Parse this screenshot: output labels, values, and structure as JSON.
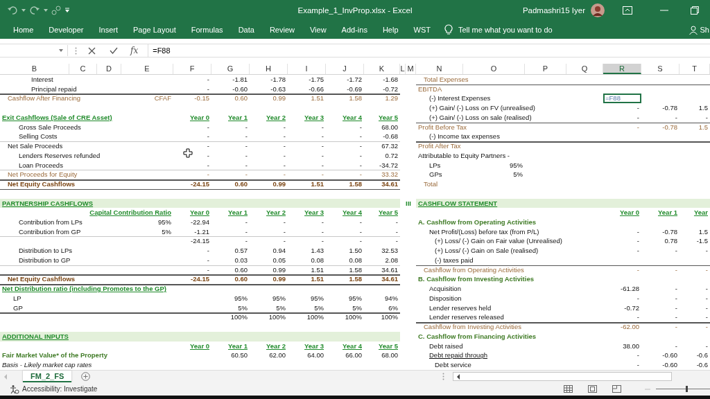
{
  "window": {
    "title": "Example_1_InvProp.xlsx  -  Excel",
    "user": "Padmashri15 Iyer"
  },
  "ribbon_tabs": [
    {
      "label": "Home",
      "selected": false
    },
    {
      "label": "Developer",
      "selected": false
    },
    {
      "label": "Insert",
      "selected": false
    },
    {
      "label": "Page Layout",
      "selected": false
    },
    {
      "label": "Formulas",
      "selected": false
    },
    {
      "label": "Data",
      "selected": false
    },
    {
      "label": "Review",
      "selected": false
    },
    {
      "label": "View",
      "selected": false
    },
    {
      "label": "Add-ins",
      "selected": false
    },
    {
      "label": "Help",
      "selected": false
    },
    {
      "label": "WST",
      "selected": false
    }
  ],
  "tell_me": {
    "placeholder": "Tell me what you want to do"
  },
  "share": {
    "label": "Sh"
  },
  "formula_bar": {
    "function_label": "fx",
    "value": "=F88"
  },
  "columns": [
    {
      "label": "B",
      "selected": false
    },
    {
      "label": "C",
      "selected": false
    },
    {
      "label": "D",
      "selected": false
    },
    {
      "label": "E",
      "selected": false
    },
    {
      "label": "F",
      "selected": false
    },
    {
      "label": "G",
      "selected": false
    },
    {
      "label": "H",
      "selected": false
    },
    {
      "label": "I",
      "selected": false
    },
    {
      "label": "J",
      "selected": false
    },
    {
      "label": "K",
      "selected": false
    },
    {
      "label": "L",
      "selected": false
    },
    {
      "label": "M",
      "selected": false
    },
    {
      "label": "N",
      "selected": false
    },
    {
      "label": "O",
      "selected": false
    },
    {
      "label": "P",
      "selected": false
    },
    {
      "label": "Q",
      "selected": false
    },
    {
      "label": "R",
      "selected": true
    },
    {
      "label": "S",
      "selected": false
    },
    {
      "label": "T",
      "selected": false
    }
  ],
  "rows": [
    {
      "left": {
        "label": "Interest",
        "kind": "detail",
        "values": [
          "-",
          "-1.81",
          "-1.78",
          "-1.75",
          "-1.72",
          "-1.68"
        ]
      },
      "right": {
        "label": "Total Expenses",
        "kind": "subtotal"
      }
    },
    {
      "left": {
        "label": "Principal repaid",
        "kind": "detail",
        "values": [
          "-",
          "-0.60",
          "-0.63",
          "-0.66",
          "-0.69",
          "-0.72"
        ]
      },
      "right": {
        "label": "EBITDA",
        "kind": "summary",
        "rule_above": true
      }
    },
    {
      "left": {
        "label": "Cashflow After Financing",
        "kind": "subtotal",
        "note": "CFAF",
        "rule_above": true,
        "values": [
          "-0.15",
          "0.60",
          "0.99",
          "1.51",
          "1.58",
          "1.29"
        ]
      },
      "right": {
        "label": "(-) Interest Expenses",
        "kind": "entry",
        "values": [
          "=F88"
        ],
        "editing": true
      }
    },
    {
      "right": {
        "label": "(+) Gain/ (-) Loss on FV (unrealised)",
        "kind": "entry",
        "values": [
          "-",
          "-0.78",
          "1.5"
        ]
      }
    },
    {
      "left": {
        "label": "Exit Cashflows (Sale of CRE Asset)",
        "kind": "heading",
        "values": [
          "Year 0",
          "Year 1",
          "Year 2",
          "Year 3",
          "Year 4",
          "Year 5"
        ]
      },
      "right": {
        "label": "(+) Gain/ (-) Loss on sale (realised)",
        "kind": "entry",
        "values": [
          "-",
          "-",
          "-"
        ]
      }
    },
    {
      "left": {
        "label": "Gross Sale Proceeds",
        "kind": "item",
        "values": [
          "-",
          "-",
          "-",
          "-",
          "-",
          "68.00"
        ]
      },
      "right": {
        "label": "Profit Before Tax",
        "kind": "summary",
        "rule_above": true,
        "values": [
          "-",
          "-0.78",
          "1.5"
        ]
      }
    },
    {
      "left": {
        "label": "Selling Costs",
        "kind": "item",
        "values": [
          "-",
          "-",
          "-",
          "-",
          "-",
          "-0.68"
        ]
      },
      "right": {
        "label": "(-) Income tax expenses",
        "kind": "entry"
      }
    },
    {
      "left": {
        "label": "Net Sale Proceeds",
        "kind": "group",
        "light_rule_above": true,
        "values": [
          "-",
          "-",
          "-",
          "-",
          "-",
          "67.32"
        ]
      },
      "right": {
        "label": "Profit After Tax",
        "kind": "summary",
        "rule_above": true
      }
    },
    {
      "left": {
        "label": "Lenders Reserves refunded",
        "kind": "item",
        "values": [
          "-",
          "-",
          "-",
          "-",
          "-",
          "0.72"
        ]
      },
      "right": {
        "label": "Attributable to Equity Partners -",
        "kind": "plain"
      }
    },
    {
      "left": {
        "label": "Loan Proceeds",
        "kind": "item",
        "values": [
          "-",
          "-",
          "-",
          "-",
          "-",
          "-34.72"
        ]
      },
      "right": {
        "label": "LPs",
        "kind": "entry",
        "note": "95%"
      }
    },
    {
      "left": {
        "label": "Net Proceeds for Equity",
        "kind": "subtotal",
        "light_rule_above": true,
        "values": [
          "-",
          "-",
          "-",
          "-",
          "-",
          "33.32"
        ]
      },
      "right": {
        "label": "GPs",
        "kind": "entry",
        "note": "5%"
      }
    },
    {
      "left": {
        "label": "Net Equity Cashflows",
        "kind": "total",
        "rule_above": true,
        "values": [
          "-24.15",
          "0.60",
          "0.99",
          "1.51",
          "1.58",
          "34.61"
        ]
      },
      "right": {
        "label": "Total",
        "kind": "subtotal"
      }
    },
    {
      "left": {
        "rule_above": true
      }
    },
    {
      "left": {
        "label": "PARTNERSHIP CASHFLOWS",
        "kind": "band"
      },
      "right": {
        "marker": "III",
        "label": "CASHFLOW STATEMENT",
        "kind": "band"
      }
    },
    {
      "left": {
        "kind": "years",
        "note": "Capital Contribution Ratio",
        "values": [
          "Year 0",
          "Year 1",
          "Year 2",
          "Year 3",
          "Year 4",
          "Year 5"
        ]
      },
      "right": {
        "kind": "years",
        "values": [
          "Year 0",
          "Year 1",
          "Year"
        ]
      }
    },
    {
      "left": {
        "label": "Contribution from LPs",
        "kind": "item",
        "note": "95%",
        "values": [
          "-22.94",
          "-",
          "-",
          "-",
          "-",
          "-"
        ]
      },
      "right": {
        "label": "A. Cashflow from Operating Activities",
        "kind": "section"
      }
    },
    {
      "left": {
        "label": "Contribution from GP",
        "kind": "item",
        "note": "5%",
        "values": [
          "-1.21",
          "-",
          "-",
          "-",
          "-",
          "-"
        ]
      },
      "right": {
        "label": "Net Profit/(Loss) before tax (from P/L)",
        "kind": "entry",
        "values": [
          "-",
          "-0.78",
          "1.5"
        ]
      }
    },
    {
      "left": {
        "kind": "item",
        "light_rule_above": true,
        "values": [
          "-24.15",
          "-",
          "-",
          "-",
          "-",
          "-"
        ]
      },
      "right": {
        "label": "(+) Loss/ (-) Gain on Fair value (Unrealised)",
        "kind": "item",
        "values": [
          "-",
          "0.78",
          "-1.5"
        ]
      }
    },
    {
      "left": {
        "label": "Distribution to LPs",
        "kind": "item",
        "values": [
          "-",
          "0.57",
          "0.94",
          "1.43",
          "1.50",
          "32.53"
        ]
      },
      "right": {
        "label": "(+) Loss/ (-) Gain on Sale (realised)",
        "kind": "item",
        "values": [
          "-",
          "-",
          "-"
        ]
      }
    },
    {
      "left": {
        "label": "Distribution to GP",
        "kind": "item",
        "values": [
          "-",
          "0.03",
          "0.05",
          "0.08",
          "0.08",
          "2.08"
        ]
      },
      "right": {
        "label": "(-) taxes paid",
        "kind": "item"
      }
    },
    {
      "left": {
        "kind": "item",
        "light_rule_above": true,
        "values": [
          "-",
          "0.60",
          "0.99",
          "1.51",
          "1.58",
          "34.61"
        ]
      },
      "right": {
        "label": "Cashflow from Operating Activities",
        "kind": "subtotal",
        "rule_above": true,
        "values": [
          "-",
          "-",
          "-"
        ]
      }
    },
    {
      "left": {
        "label": "Net Equity Cashflows",
        "kind": "total",
        "rule_above": true,
        "values": [
          "-24.15",
          "0.60",
          "0.99",
          "1.51",
          "1.58",
          "34.61"
        ]
      },
      "right": {
        "label": "B. Cashflow from Investing Activities",
        "kind": "section"
      }
    },
    {
      "left": {
        "label": "Net Distribution ratio (including Promotes to the GP)",
        "kind": "heading",
        "rule_above": true
      },
      "right": {
        "label": "Acquisition",
        "kind": "entry",
        "values": [
          "-61.28",
          "-",
          "-"
        ]
      }
    },
    {
      "left": {
        "label": "LP",
        "kind": "entry",
        "later_values": [
          "95%",
          "95%",
          "95%",
          "95%",
          "94%"
        ]
      },
      "right": {
        "label": "Disposition",
        "kind": "entry",
        "values": [
          "-",
          "-",
          "-"
        ]
      }
    },
    {
      "left": {
        "label": "GP",
        "kind": "entry",
        "later_values": [
          "5%",
          "5%",
          "5%",
          "5%",
          "6%"
        ]
      },
      "right": {
        "label": "Lender reserves held",
        "kind": "entry",
        "values": [
          "-0.72",
          "-",
          "-"
        ]
      }
    },
    {
      "left": {
        "kind": "item",
        "rule_above": true,
        "later_values": [
          "100%",
          "100%",
          "100%",
          "100%",
          "100%"
        ]
      },
      "right": {
        "label": "Lender reserves released",
        "kind": "entry",
        "values": [
          "-",
          "-",
          "-"
        ]
      }
    },
    {
      "right": {
        "label": "Cashflow from Investing Activities",
        "kind": "subtotal",
        "rule_above": true,
        "values": [
          "-62.00",
          "-",
          "-"
        ]
      }
    },
    {
      "left": {
        "label": "ADDITIONAL INPUTS",
        "kind": "band"
      },
      "right": {
        "label": "C. Cashflow from Financing Activities",
        "kind": "section"
      }
    },
    {
      "left": {
        "kind": "years",
        "values": [
          "Year 0",
          "Year 1",
          "Year 2",
          "Year 3",
          "Year 4",
          "Year 5"
        ]
      },
      "right": {
        "label": "Debt raised",
        "kind": "entry",
        "values": [
          "38.00",
          "-",
          "-"
        ]
      }
    },
    {
      "left": {
        "label": "Fair Market Value* of the Property",
        "kind": "section",
        "later_values": [
          "60.50",
          "62.00",
          "64.00",
          "66.00",
          "68.00"
        ]
      },
      "right": {
        "label": "Debt repaid through",
        "kind": "underlined",
        "values": [
          "-",
          "-0.60",
          "-0.6"
        ]
      }
    },
    {
      "left": {
        "label": "Basis - Likely market cap rates",
        "kind": "remark"
      },
      "right": {
        "label": "Debt service",
        "kind": "item",
        "values": [
          "-",
          "-0.60",
          "-0.6"
        ]
      }
    }
  ],
  "sheet_tabs": [
    {
      "label": "FM_2_FS",
      "selected": true
    }
  ],
  "status_bar": {
    "accessibility": "Accessibility: Investigate",
    "zoom": {
      "level": 0.55
    }
  }
}
